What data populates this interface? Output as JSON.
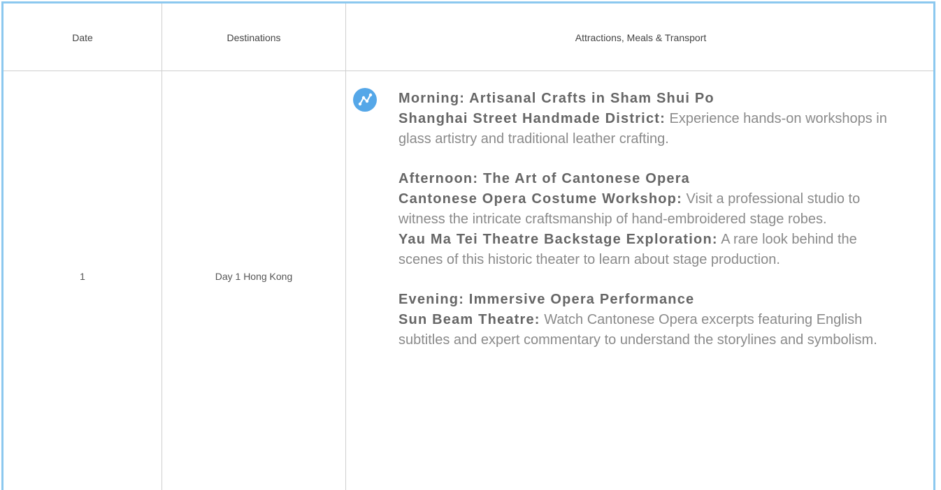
{
  "headers": {
    "date": "Date",
    "destinations": "Destinations",
    "attractions": "Attractions, Meals & Transport"
  },
  "row": {
    "date": "1",
    "destination": "Day 1 Hong Kong",
    "icon": "route-icon",
    "sections": [
      {
        "title": "Morning: Artisanal Crafts in Sham Shui Po",
        "items": [
          {
            "name": "Shanghai Street Handmade District:",
            "text": " Experience hands-on workshops in glass artistry and traditional leather crafting."
          }
        ]
      },
      {
        "title": "Afternoon: The Art of Cantonese Opera",
        "items": [
          {
            "name": "Cantonese Opera Costume Workshop:",
            "text": " Visit a professional studio to witness the intricate craftsmanship of hand-embroidered stage robes."
          },
          {
            "name": "Yau Ma Tei Theatre Backstage Exploration:",
            "text": " A rare look behind the scenes of this historic theater to learn about stage production."
          }
        ]
      },
      {
        "title": "Evening: Immersive Opera Performance",
        "items": [
          {
            "name": "Sun Beam Theatre:",
            "text": " Watch Cantonese Opera excerpts featuring English subtitles and expert commentary to understand the storylines and symbolism."
          }
        ]
      }
    ]
  },
  "colors": {
    "border_accent": "#8cc8ef",
    "icon_background": "#55a7e8"
  }
}
